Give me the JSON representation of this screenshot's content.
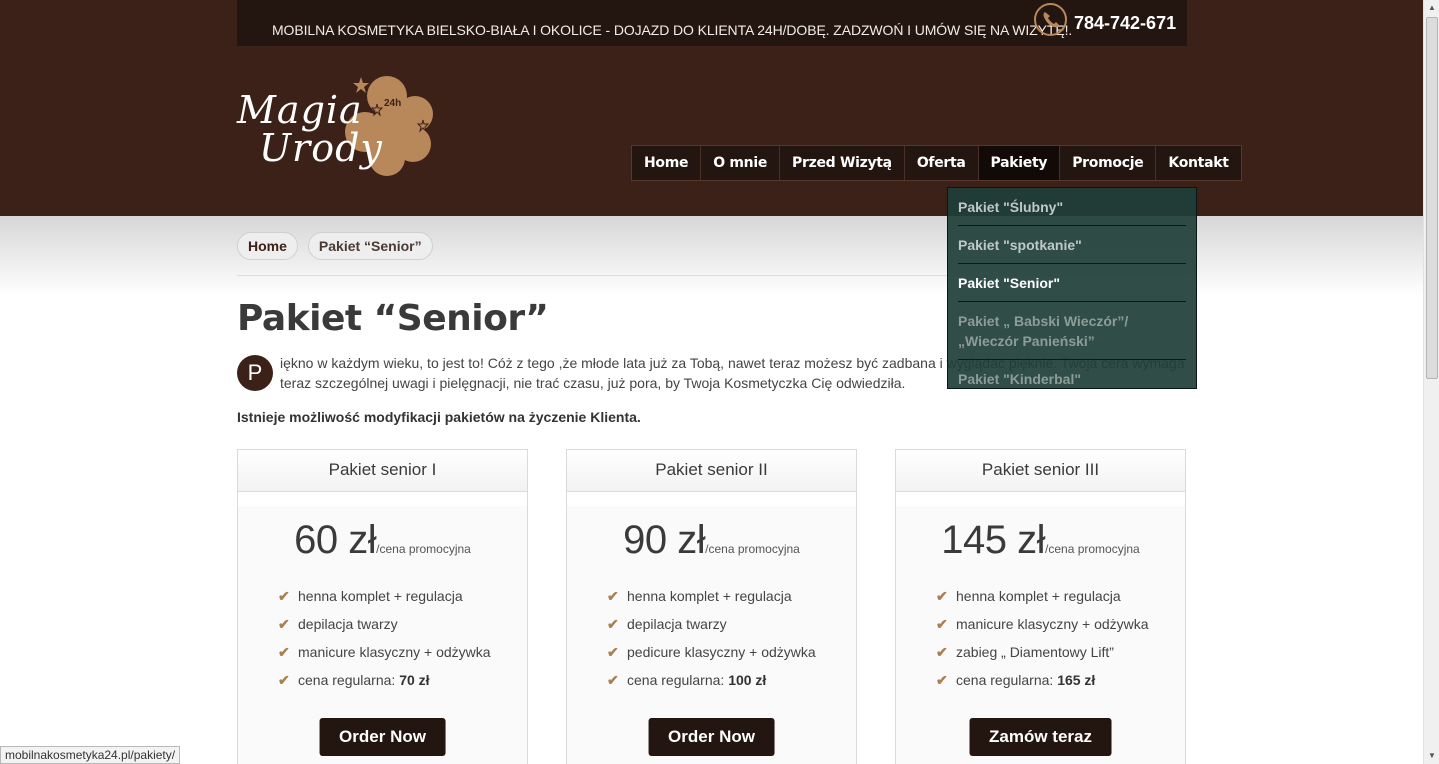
{
  "topbar": {
    "text": "MOBILNA KOSMETYKA BIELSKO-BIAŁA I OKOLICE - DOJAZD DO KLIENTA 24H/DOBĘ. ZADZWOŃ I UMÓW SIĘ NA WIZYTĘ!.",
    "phone": "784-742-671",
    "phone_icon": "phone-icon"
  },
  "logo": {
    "line1": "Magia",
    "line2": "Urody",
    "badge": "24h"
  },
  "nav": {
    "items": [
      {
        "label": "Home"
      },
      {
        "label": "O mnie"
      },
      {
        "label": "Przed Wizytą"
      },
      {
        "label": "Oferta"
      },
      {
        "label": "Pakiety",
        "active": true
      },
      {
        "label": "Promocje"
      },
      {
        "label": "Kontakt"
      }
    ]
  },
  "dropdown": {
    "items": [
      {
        "label": "Pakiet \"Ślubny\""
      },
      {
        "label": "Pakiet \"spotkanie\""
      },
      {
        "label": "Pakiet \"Senior\""
      },
      {
        "label": "Pakiet „ Babski Wieczór”/ „Wieczór Panieński”"
      },
      {
        "label": "Pakiet \"Kinderbal\""
      }
    ]
  },
  "breadcrumb": {
    "home": "Home",
    "current": "Pakiet “Senior”"
  },
  "page": {
    "title": "Pakiet “Senior”",
    "dropcap": "P",
    "intro_line1": "iękno w każdym wieku, to jest to! Cóż z tego ,że młode lata już za Tobą, nawet teraz możesz być zadbana i wyglądać pięknie. Twoja cera wymaga",
    "intro_line2": "teraz szczególnej uwagi i pielęgnacji, nie trać czasu, już pora, by Twoja Kosmetyczka Cię odwiedziła.",
    "note": "Istnieje możliwość modyfikacji pakietów na życzenie Klienta."
  },
  "cards": [
    {
      "title": "Pakiet senior I",
      "price": "60 zł",
      "price_note": "/cena promocyjna",
      "features": [
        "henna komplet + regulacja",
        "depilacja twarzy",
        "manicure klasyczny + odżywka"
      ],
      "regular_label": "cena regularna: ",
      "regular_price": "70 zł",
      "button": "Order Now"
    },
    {
      "title": "Pakiet senior II",
      "price": "90 zł",
      "price_note": "/cena promocyjna",
      "features": [
        "henna komplet + regulacja",
        "depilacja twarzy",
        "pedicure klasyczny + odżywka"
      ],
      "regular_label": "cena regularna: ",
      "regular_price": "100 zł",
      "button": "Order Now"
    },
    {
      "title": "Pakiet senior III",
      "price": "145 zł",
      "price_note": "/cena promocyjna",
      "features": [
        "henna komplet + regulacja",
        "manicure klasyczny + odżywka",
        "zabieg „ Diamentowy Lift”"
      ],
      "regular_label": "cena regularna: ",
      "regular_price": "165 zł",
      "button": "Zamów teraz"
    }
  ],
  "statusbar": {
    "url": "mobilnakosmetyka24.pl/pakiety/"
  },
  "colors": {
    "header": "#3c2119",
    "accent": "#a98052",
    "dropdown": "#203e38"
  }
}
